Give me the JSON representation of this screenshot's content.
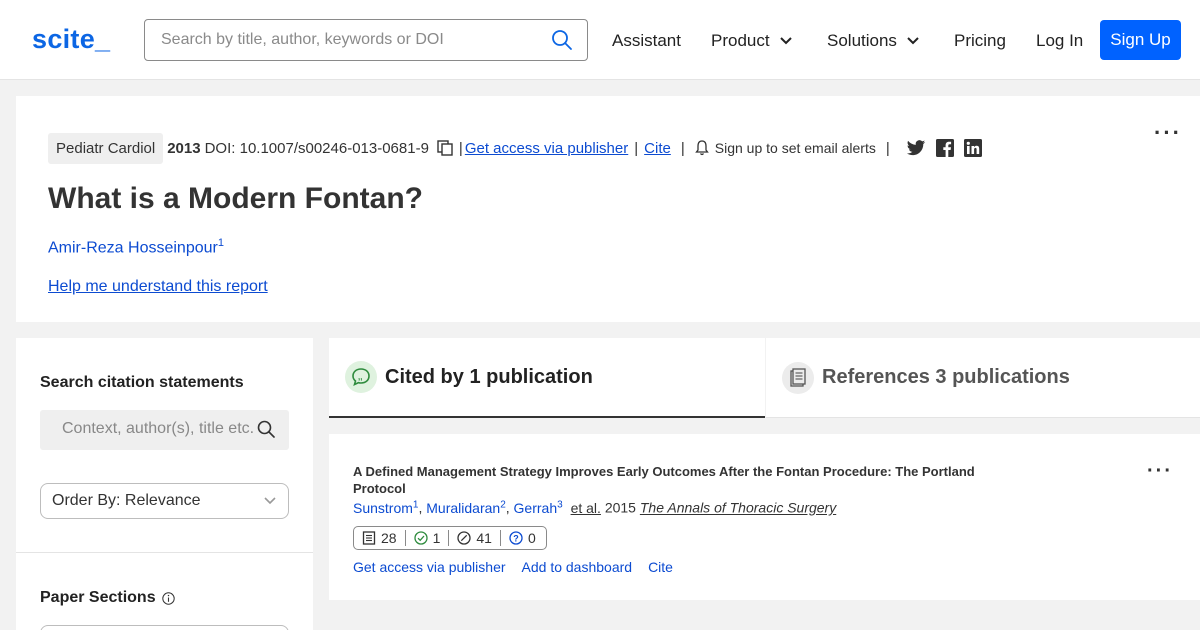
{
  "nav": {
    "logo": "scite_",
    "search_placeholder": "Search by title, author, keywords or DOI",
    "items": [
      {
        "label": "Assistant"
      },
      {
        "label": "Product"
      },
      {
        "label": "Solutions"
      },
      {
        "label": "Pricing"
      },
      {
        "label": "Log In"
      }
    ],
    "signup_label": "Sign Up",
    "accent_color": "#0062ff"
  },
  "paper": {
    "journal": "Pediatr Cardiol",
    "year": "2013",
    "doi": "DOI: 10.1007/s00246-013-0681-9",
    "access_label": "Get access via publisher",
    "cite_label": "Cite",
    "alert_label": "Sign up to set email alerts",
    "title": "What is a Modern Fontan?",
    "author": "Amir-Reza Hosseinpour",
    "author_sup": "1",
    "help_label": "Help me understand this report",
    "social_icons": [
      "twitter-icon",
      "facebook-icon",
      "linkedin-icon"
    ]
  },
  "sidebar": {
    "search_heading": "Search citation statements",
    "search_placeholder": "Context, author(s), title etc.",
    "order_label": "Order By: Relevance",
    "sections_heading": "Paper Sections"
  },
  "tabs": {
    "cited": "Cited by 1 publication",
    "references": "References 3 publications"
  },
  "result": {
    "title": "A Defined Management Strategy Improves Early Outcomes After the Fontan Procedure: The Portland Protocol",
    "authors": [
      {
        "name": "Sunstrom",
        "sup": "1"
      },
      {
        "name": "Muralidaran",
        "sup": "2"
      },
      {
        "name": "Gerrah",
        "sup": "3"
      }
    ],
    "etal": "et al.",
    "year": "2015",
    "journal": "The Annals of Thoracic Surgery",
    "tally": {
      "publications": "28",
      "supporting": "1",
      "mentioning": "41",
      "contrasting": "0"
    },
    "actions": [
      "Get access via publisher",
      "Add to dashboard",
      "Cite"
    ]
  }
}
